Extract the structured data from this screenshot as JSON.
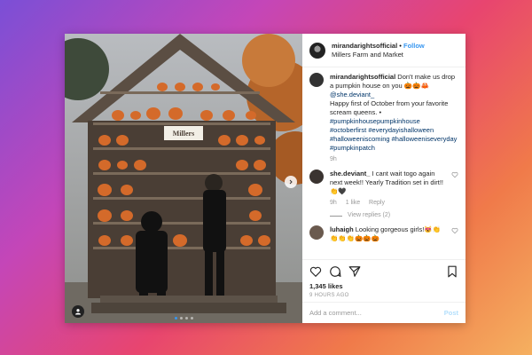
{
  "post": {
    "username": "mirandarightsofficial",
    "follow_label": "Follow",
    "separator": "•",
    "location": "Millers Farm and Market",
    "sign_text": "Millers",
    "caption": {
      "username": "mirandarightsofficial",
      "text1": "Don't make us drop a pumpkin house on you 🎃🎃🦀",
      "mention": "@she.deviant_",
      "text2": "Happy first of October from your favorite scream queens. •",
      "hashtags": "#pumpkinhousepumpkinhouse #octoberfirst #everydayishalloween #halloweeniscoming #halloweeniseveryday #pumpkinpatch",
      "age": "9h"
    },
    "comments": [
      {
        "username": "she.deviant_",
        "text": "I cant wait togo again next week!! Yearly Tradition set in dirt!!👏🖤",
        "age": "9h",
        "likes": "1 like",
        "reply": "Reply",
        "view_replies": "View replies (2)"
      },
      {
        "username": "luhaigh",
        "text": "Looking gorgeous girls!😻👏👏👏👏🎃🎃🎃"
      }
    ],
    "likes": "1,345 likes",
    "timestamp": "9 HOURS AGO",
    "add_comment_placeholder": "Add a comment...",
    "post_label": "Post"
  },
  "icons": {
    "like": "heart-icon",
    "comment": "comment-icon",
    "share": "share-icon",
    "save": "bookmark-icon"
  },
  "colors": {
    "link": "#3897f0",
    "hashtag": "#003569"
  }
}
